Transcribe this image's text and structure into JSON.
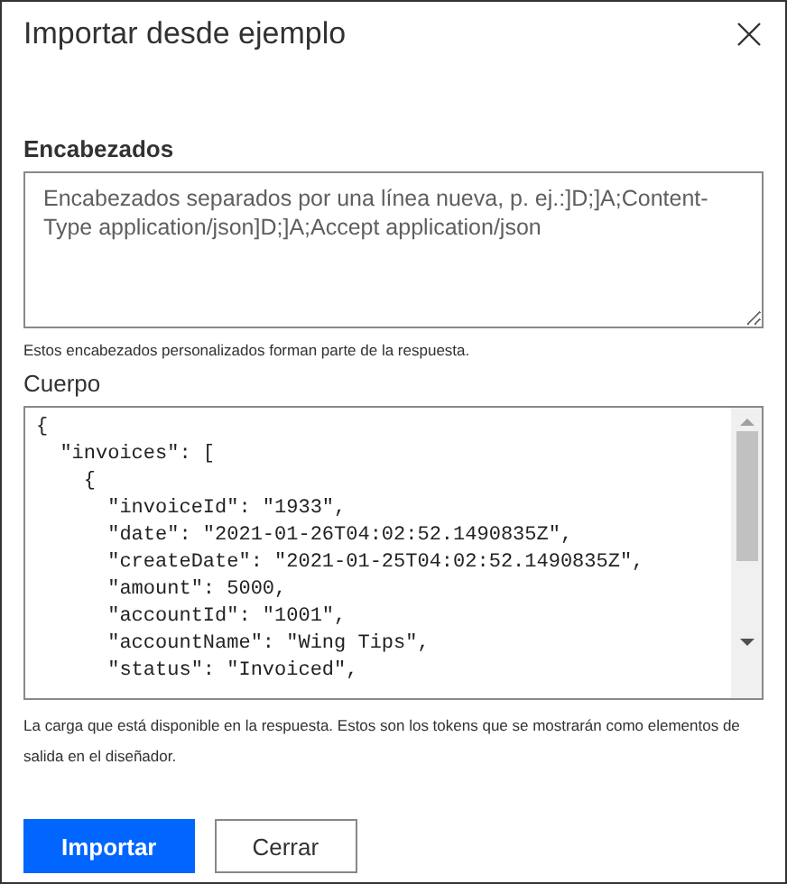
{
  "dialog": {
    "title": "Importar desde ejemplo"
  },
  "headers": {
    "label": "Encabezados",
    "placeholder": "Encabezados separados por una línea nueva, p. ej.:]D;]A;Content-Type application/json]D;]A;Accept application/json",
    "help": "Estos encabezados personalizados forman parte de la respuesta."
  },
  "body": {
    "label": "Cuerpo",
    "lines": [
      "{",
      "  \"invoices\": [",
      "    {",
      "      \"invoiceId\": \"1933\",",
      "      \"date\": \"2021-01-26T04:02:52.1490835Z\",",
      "      \"createDate\": \"2021-01-25T04:02:52.1490835Z\",",
      "      \"amount\": 5000,",
      "      \"accountId\": \"1001\",",
      "      \"accountName\": \"Wing Tips\",",
      "      \"status\": \"Invoiced\","
    ],
    "help": "La carga que está disponible en la respuesta. Estos son los tokens que se mostrarán como elementos de salida en el diseñador."
  },
  "buttons": [
    {
      "label": "Importar",
      "kind": "primary"
    },
    {
      "label": "Cerrar",
      "kind": "secondary"
    }
  ]
}
